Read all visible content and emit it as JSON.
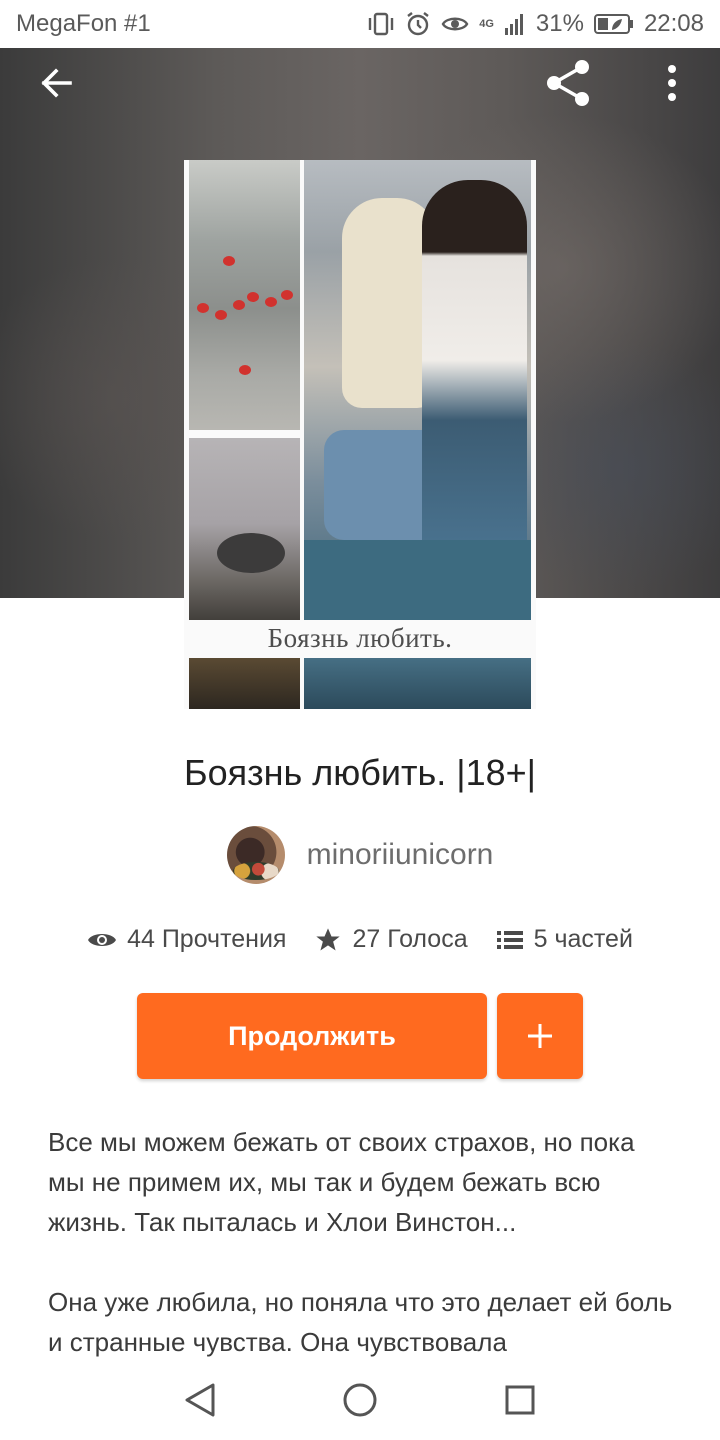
{
  "status_bar": {
    "carrier": "MegaFon #1",
    "network": "4G",
    "battery": "31%",
    "time": "22:08",
    "icons": [
      "vibrate-icon",
      "alarm-icon",
      "eye-comfort-icon",
      "signal-icon",
      "battery-icon"
    ]
  },
  "header": {
    "back_icon": "arrow-back-icon",
    "share_icon": "share-icon",
    "more_icon": "more-vertical-icon"
  },
  "cover": {
    "title": "Боязнь любить."
  },
  "story": {
    "title": "Боязнь любить. |18+|",
    "author": "minoriiunicorn"
  },
  "stats": {
    "reads": "44 Прочтения",
    "votes": "27 Голоса",
    "parts": "5 частей"
  },
  "actions": {
    "continue_label": "Продолжить",
    "add_icon": "plus-icon"
  },
  "description": {
    "paragraph_1": "Все мы можем бежать от своих страхов, но пока мы не примем их, мы так и будем бежать всю жизнь. Так пыталась и Хлои Винстон...",
    "paragraph_2": "Она уже любила, но поняла что это делает ей боль и странные чувства. Она чувствовала"
  },
  "colors": {
    "accent": "#ff6a1f",
    "text_primary": "#222222",
    "text_secondary": "#6d6d6d"
  }
}
